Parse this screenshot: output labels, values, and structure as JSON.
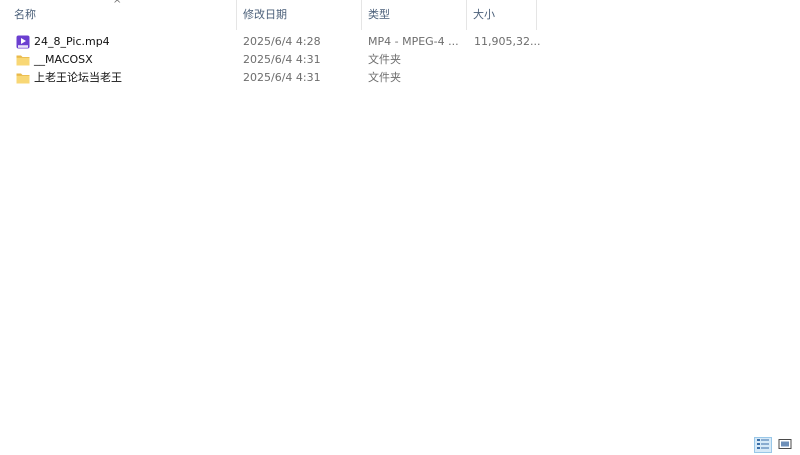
{
  "columns": {
    "name": "名称",
    "date": "修改日期",
    "type": "类型",
    "size": "大小",
    "sort_indicator": "^"
  },
  "files": [
    {
      "name": "24_8_Pic.mp4",
      "date": "2025/6/4 4:28",
      "type": "MP4 - MPEG-4 ...",
      "size": "11,905,32...",
      "icon": "video-file-icon"
    },
    {
      "name": "__MACOSX",
      "date": "2025/6/4 4:31",
      "type": "文件夹",
      "size": "",
      "icon": "folder-icon"
    },
    {
      "name": "上老王论坛当老王",
      "date": "2025/6/4 4:31",
      "type": "文件夹",
      "size": "",
      "icon": "folder-icon"
    }
  ],
  "view_buttons": {
    "details": "details-view-icon",
    "large_icons": "large-icons-view-icon",
    "active": "details"
  },
  "colors": {
    "header_text": "#4c607a",
    "secondary_text": "#6d6d6d",
    "folder": "#f8d775",
    "video_icon": "#6b3fd0",
    "active_view": "#d7eaf8"
  }
}
